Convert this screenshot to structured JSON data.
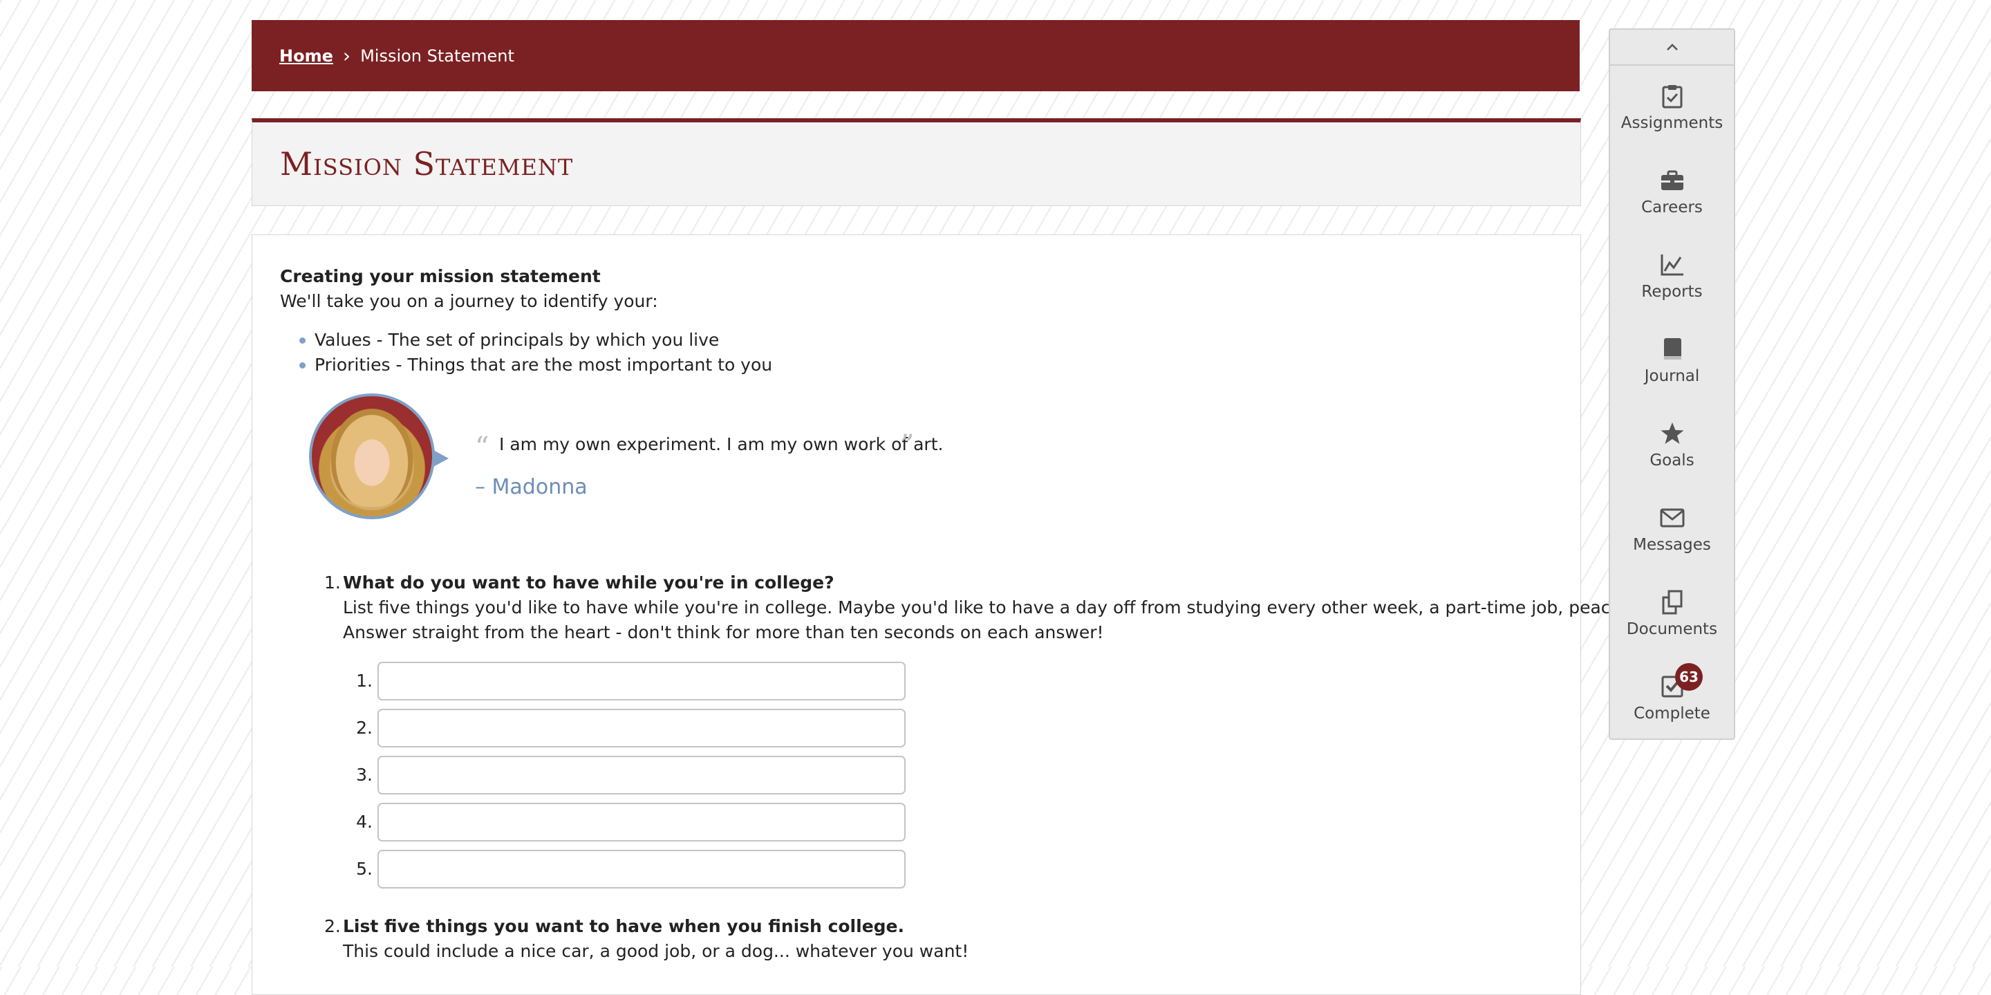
{
  "breadcrumb": {
    "home": "Home",
    "separator": "›",
    "current": "Mission Statement"
  },
  "page_title": "Mission Statement",
  "intro": {
    "heading": "Creating your mission statement",
    "text": "We'll take you on a journey to identify your:",
    "bullets": [
      "Values - The set of principals by which you live",
      "Priorities - Things that are the most important to you"
    ]
  },
  "quote": {
    "open_mark": "“",
    "close_mark": "”",
    "text": "I am my own experiment. I am my own work of art.",
    "author": "– Madonna"
  },
  "questions": [
    {
      "number": "1.",
      "title": "What do you want to have while you're in college?",
      "desc1": "List five things you'd like to have while you're in college. Maybe you'd like to have a day off from studying every other week, a part-time job, peace and quiet.",
      "desc2": "Answer straight from the heart - don't think for more than ten seconds on each answer!",
      "fields": [
        {
          "label": "1.",
          "value": ""
        },
        {
          "label": "2.",
          "value": ""
        },
        {
          "label": "3.",
          "value": ""
        },
        {
          "label": "4.",
          "value": ""
        },
        {
          "label": "5.",
          "value": ""
        }
      ]
    },
    {
      "number": "2.",
      "title": "List five things you want to have when you finish college.",
      "desc1": "This could include a nice car, a good job, or a dog... whatever you want!"
    }
  ],
  "sidebar": {
    "collapse_icon": "chevron-up-icon",
    "items": [
      {
        "label": "Assignments",
        "icon": "clipboard-check-icon"
      },
      {
        "label": "Careers",
        "icon": "briefcase-icon"
      },
      {
        "label": "Reports",
        "icon": "line-chart-icon"
      },
      {
        "label": "Journal",
        "icon": "book-icon"
      },
      {
        "label": "Goals",
        "icon": "star-icon"
      },
      {
        "label": "Messages",
        "icon": "envelope-icon"
      },
      {
        "label": "Documents",
        "icon": "copy-icon"
      },
      {
        "label": "Complete",
        "icon": "check-square-icon",
        "badge": "63"
      }
    ]
  },
  "colors": {
    "brand": "#7b2123",
    "accent_blue": "#6c8db7",
    "panel_bg": "#f3f3f3"
  }
}
